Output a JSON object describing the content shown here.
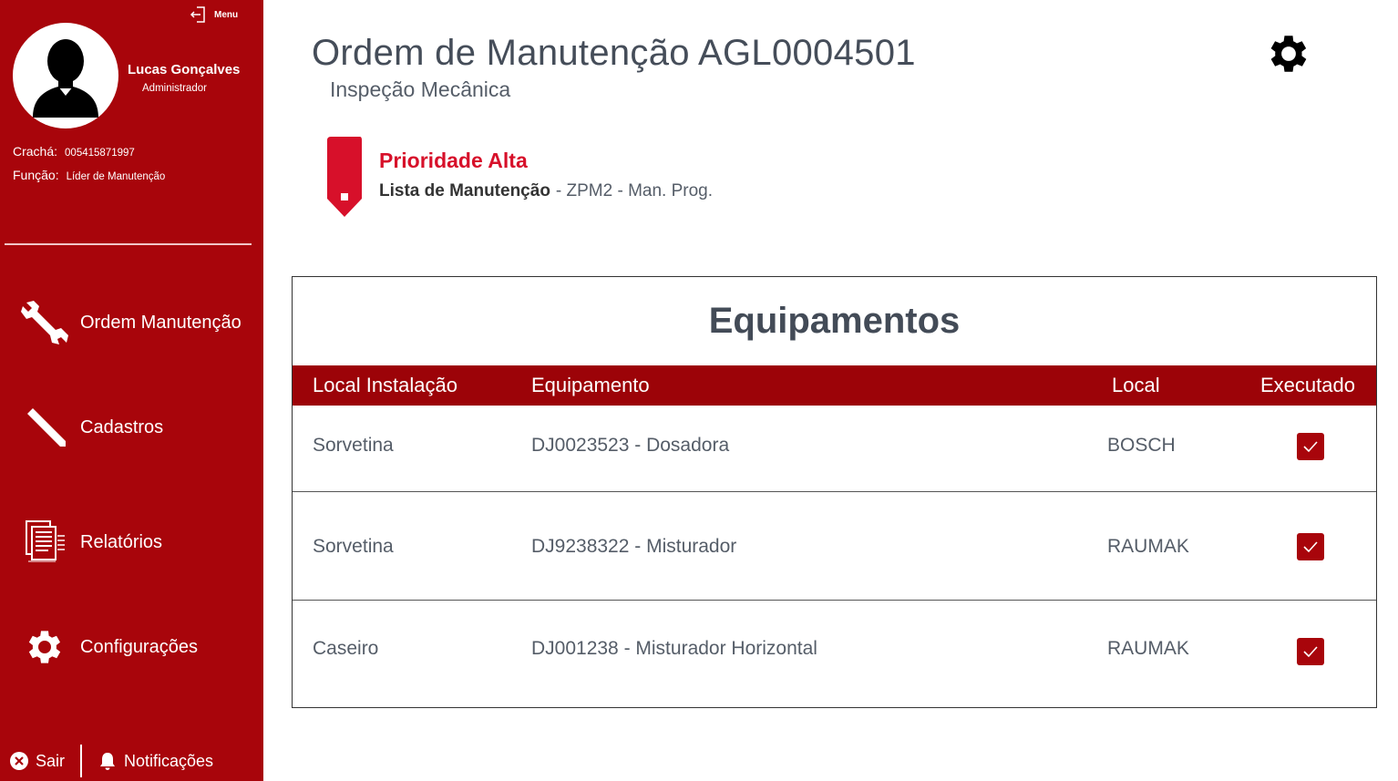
{
  "sidebar": {
    "menu_label": "Menu",
    "user": {
      "name": "Lucas Gonçalves",
      "role": "Administrador"
    },
    "badge_label": "Crachá:",
    "badge_value": "005415871997",
    "function_label": "Função:",
    "function_value": "Líder de Manutenção",
    "nav": [
      {
        "label": "Ordem Manutenção",
        "icon": "wrench-icon"
      },
      {
        "label": "Cadastros",
        "icon": "pencil-icon"
      },
      {
        "label": "Relatórios",
        "icon": "report-icon"
      },
      {
        "label": "Configurações",
        "icon": "gear-icon"
      }
    ],
    "exit_label": "Sair",
    "notifications_label": "Notificações"
  },
  "header": {
    "title": "Ordem de Manutenção AGL0004501",
    "subtitle": "Inspeção Mecânica"
  },
  "priority": {
    "title": "Prioridade Alta",
    "list_label": "Lista de Manutenção",
    "list_value": "- ZPM2 - Man. Prog."
  },
  "equipment": {
    "title": "Equipamentos",
    "columns": [
      "Local Instalação",
      "Equipamento",
      "Local",
      "Executado"
    ],
    "rows": [
      {
        "local_instalacao": "Sorvetina",
        "equipamento": "DJ0023523 - Dosadora",
        "local": "BOSCH",
        "executado": true
      },
      {
        "local_instalacao": "Sorvetina",
        "equipamento": "DJ9238322 - Misturador",
        "local": "RAUMAK",
        "executado": true
      },
      {
        "local_instalacao": "Caseiro",
        "equipamento": "DJ001238 - Misturador Horizontal",
        "local": "RAUMAK",
        "executado": true
      }
    ]
  },
  "colors": {
    "sidebar": "#a8050b",
    "table_header": "#9c0308",
    "priority": "#d7102a",
    "text": "#454d59"
  }
}
